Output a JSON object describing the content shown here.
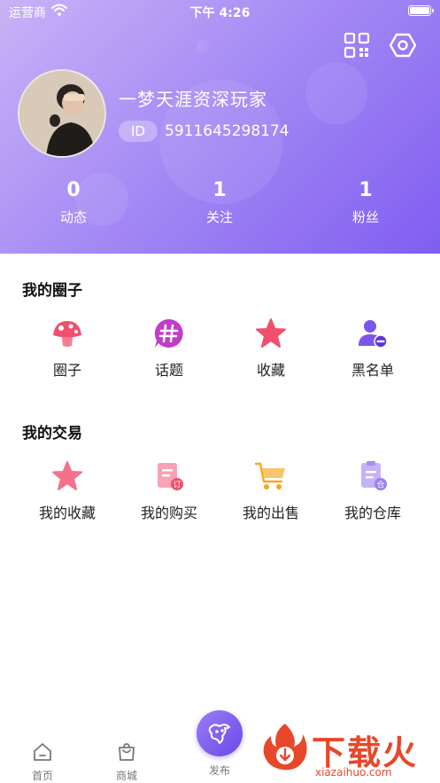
{
  "status_bar": {
    "carrier": "运营商",
    "time": "下午 4:26"
  },
  "profile": {
    "username": "一梦天涯资深玩家",
    "id_label": "ID",
    "id_number": "5911645298174",
    "stats": [
      {
        "value": "0",
        "label": "动态"
      },
      {
        "value": "1",
        "label": "关注"
      },
      {
        "value": "1",
        "label": "粉丝"
      }
    ]
  },
  "circles_section": {
    "title": "我的圈子",
    "items": [
      {
        "label": "圈子",
        "icon": "mushroom-icon"
      },
      {
        "label": "话题",
        "icon": "hashtag-icon"
      },
      {
        "label": "收藏",
        "icon": "star-icon"
      },
      {
        "label": "黑名单",
        "icon": "user-block-icon"
      }
    ]
  },
  "trade_section": {
    "title": "我的交易",
    "items": [
      {
        "label": "我的收藏",
        "icon": "star-icon"
      },
      {
        "label": "我的购买",
        "icon": "order-doc-icon"
      },
      {
        "label": "我的出售",
        "icon": "cart-icon"
      },
      {
        "label": "我的仓库",
        "icon": "warehouse-doc-icon"
      }
    ]
  },
  "tab_bar": {
    "home": "首页",
    "mall": "商城",
    "publish": "发布"
  },
  "watermark": {
    "name": "下载火",
    "url": "xiazaihuo.com"
  },
  "colors": {
    "header_start": "#c9b3f6",
    "header_end": "#7f5ef0",
    "accent_pink": "#f0506e",
    "accent_purple": "#7b55ee",
    "accent_orange": "#f5a623",
    "watermark_red": "#e8472a"
  }
}
